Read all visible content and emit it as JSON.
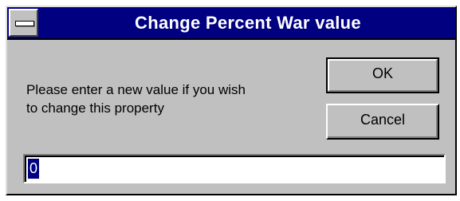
{
  "window": {
    "title": "Change Percent War value",
    "sysmenu_icon": "system-menu-icon"
  },
  "prompt": {
    "line1": "Please enter a new value if you wish",
    "line2": "to change this property"
  },
  "buttons": {
    "ok_label": "OK",
    "cancel_label": "Cancel"
  },
  "input": {
    "value": "0",
    "selected": true
  },
  "colors": {
    "titlebar": "#000080",
    "dialog_face": "#c0c0c0",
    "selection": "#000080"
  }
}
